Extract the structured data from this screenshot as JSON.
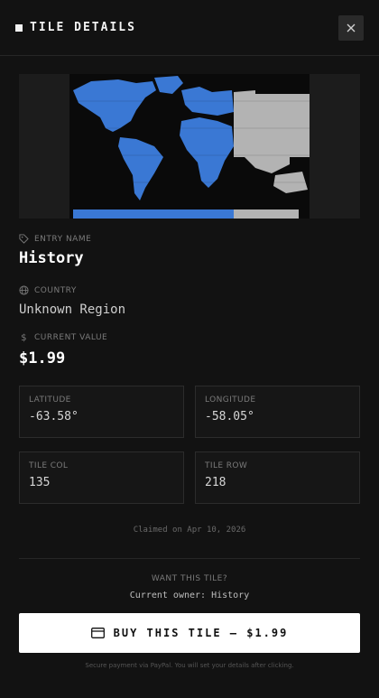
{
  "header": {
    "title": "TILE DETAILS",
    "icon": "square-icon",
    "close_icon": "close-icon"
  },
  "map": {
    "image": "world-map-tile",
    "ocean_color": "#0a0a0a",
    "land_color": "#3a78d4",
    "claimed_color": "#b3b3b3"
  },
  "entry": {
    "label": "ENTRY NAME",
    "value": "History",
    "icon": "tag-icon"
  },
  "country": {
    "label": "COUNTRY",
    "value": "Unknown Region",
    "icon": "globe-icon"
  },
  "current_value": {
    "label": "CURRENT VALUE",
    "value": "$1.99",
    "icon": "dollar-icon"
  },
  "coords": [
    {
      "label": "LATITUDE",
      "value": "-63.58°"
    },
    {
      "label": "LONGITUDE",
      "value": "-58.05°"
    },
    {
      "label": "TILE COL",
      "value": "135"
    },
    {
      "label": "TILE ROW",
      "value": "218"
    }
  ],
  "claimed_text": "Claimed on Apr 10, 2026",
  "want": {
    "label": "WANT THIS TILE?",
    "owner_text": "Current owner: History"
  },
  "buy": {
    "label": "BUY THIS TILE — $1.99",
    "icon": "credit-card-icon",
    "bg_color": "#ffffff"
  },
  "secure_text": "Secure payment via PayPal. You will set your details after clicking."
}
